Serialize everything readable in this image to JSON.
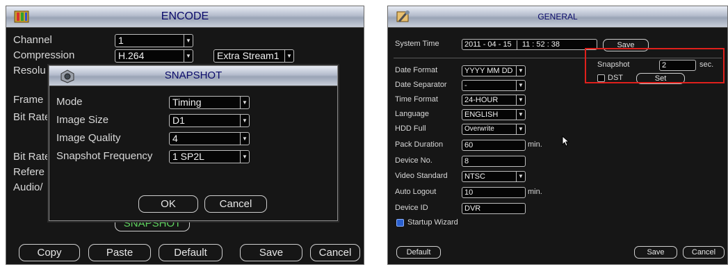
{
  "encode": {
    "title": "ENCODE",
    "labels": {
      "channel": "Channel",
      "compression": "Compression",
      "resolution": "Resolu",
      "frame": "Frame",
      "bitrate1": "Bit Rate",
      "bitrate2": "Bit Rate",
      "reference": "Refere",
      "audio": "Audio/"
    },
    "channel_value": "1",
    "compression_value": "H.264",
    "extra_stream_value": "Extra Stream1",
    "snapshot_button": "SNAPSHOT",
    "buttons": {
      "copy": "Copy",
      "paste": "Paste",
      "default": "Default",
      "save": "Save",
      "cancel": "Cancel"
    }
  },
  "snapshot_dialog": {
    "title": "SNAPSHOT",
    "mode_label": "Mode",
    "mode_value": "Timing",
    "image_size_label": "Image Size",
    "image_size_value": "D1",
    "image_quality_label": "Image Quality",
    "image_quality_value": "4",
    "frequency_label": "Snapshot Frequency",
    "frequency_value": "1 SP2L",
    "ok": "OK",
    "cancel": "Cancel"
  },
  "general": {
    "title": "GENERAL",
    "system_time_label": "System Time",
    "system_time_date": "2011 - 04 - 15",
    "system_time_clock": "11 : 52 : 38",
    "save_time": "Save",
    "date_format_label": "Date Format",
    "date_format_value": "YYYY MM DD",
    "date_separator_label": "Date Separator",
    "date_separator_value": "-",
    "time_format_label": "Time Format",
    "time_format_value": "24-HOUR",
    "language_label": "Language",
    "language_value": "ENGLISH",
    "hdd_full_label": "HDD Full",
    "hdd_full_value": "Overwrite",
    "pack_duration_label": "Pack Duration",
    "pack_duration_value": "60",
    "pack_duration_unit": "min.",
    "device_no_label": "Device No.",
    "device_no_value": "8",
    "video_standard_label": "Video Standard",
    "video_standard_value": "NTSC",
    "auto_logout_label": "Auto Logout",
    "auto_logout_value": "10",
    "auto_logout_unit": "min.",
    "device_id_label": "Device ID",
    "device_id_value": "DVR",
    "startup_wizard_label": "Startup Wizard",
    "snapshot_label": "Snapshot",
    "snapshot_value": "2",
    "snapshot_unit": "sec.",
    "dst_label": "DST",
    "set_button": "Set",
    "default_button": "Default",
    "save_button": "Save",
    "cancel_button": "Cancel"
  },
  "colors": {
    "highlight_box": "#e0201c",
    "panel_bg": "#161616",
    "title_text": "#0a0a6a",
    "snapshot_button_text": "#5fd35f"
  }
}
